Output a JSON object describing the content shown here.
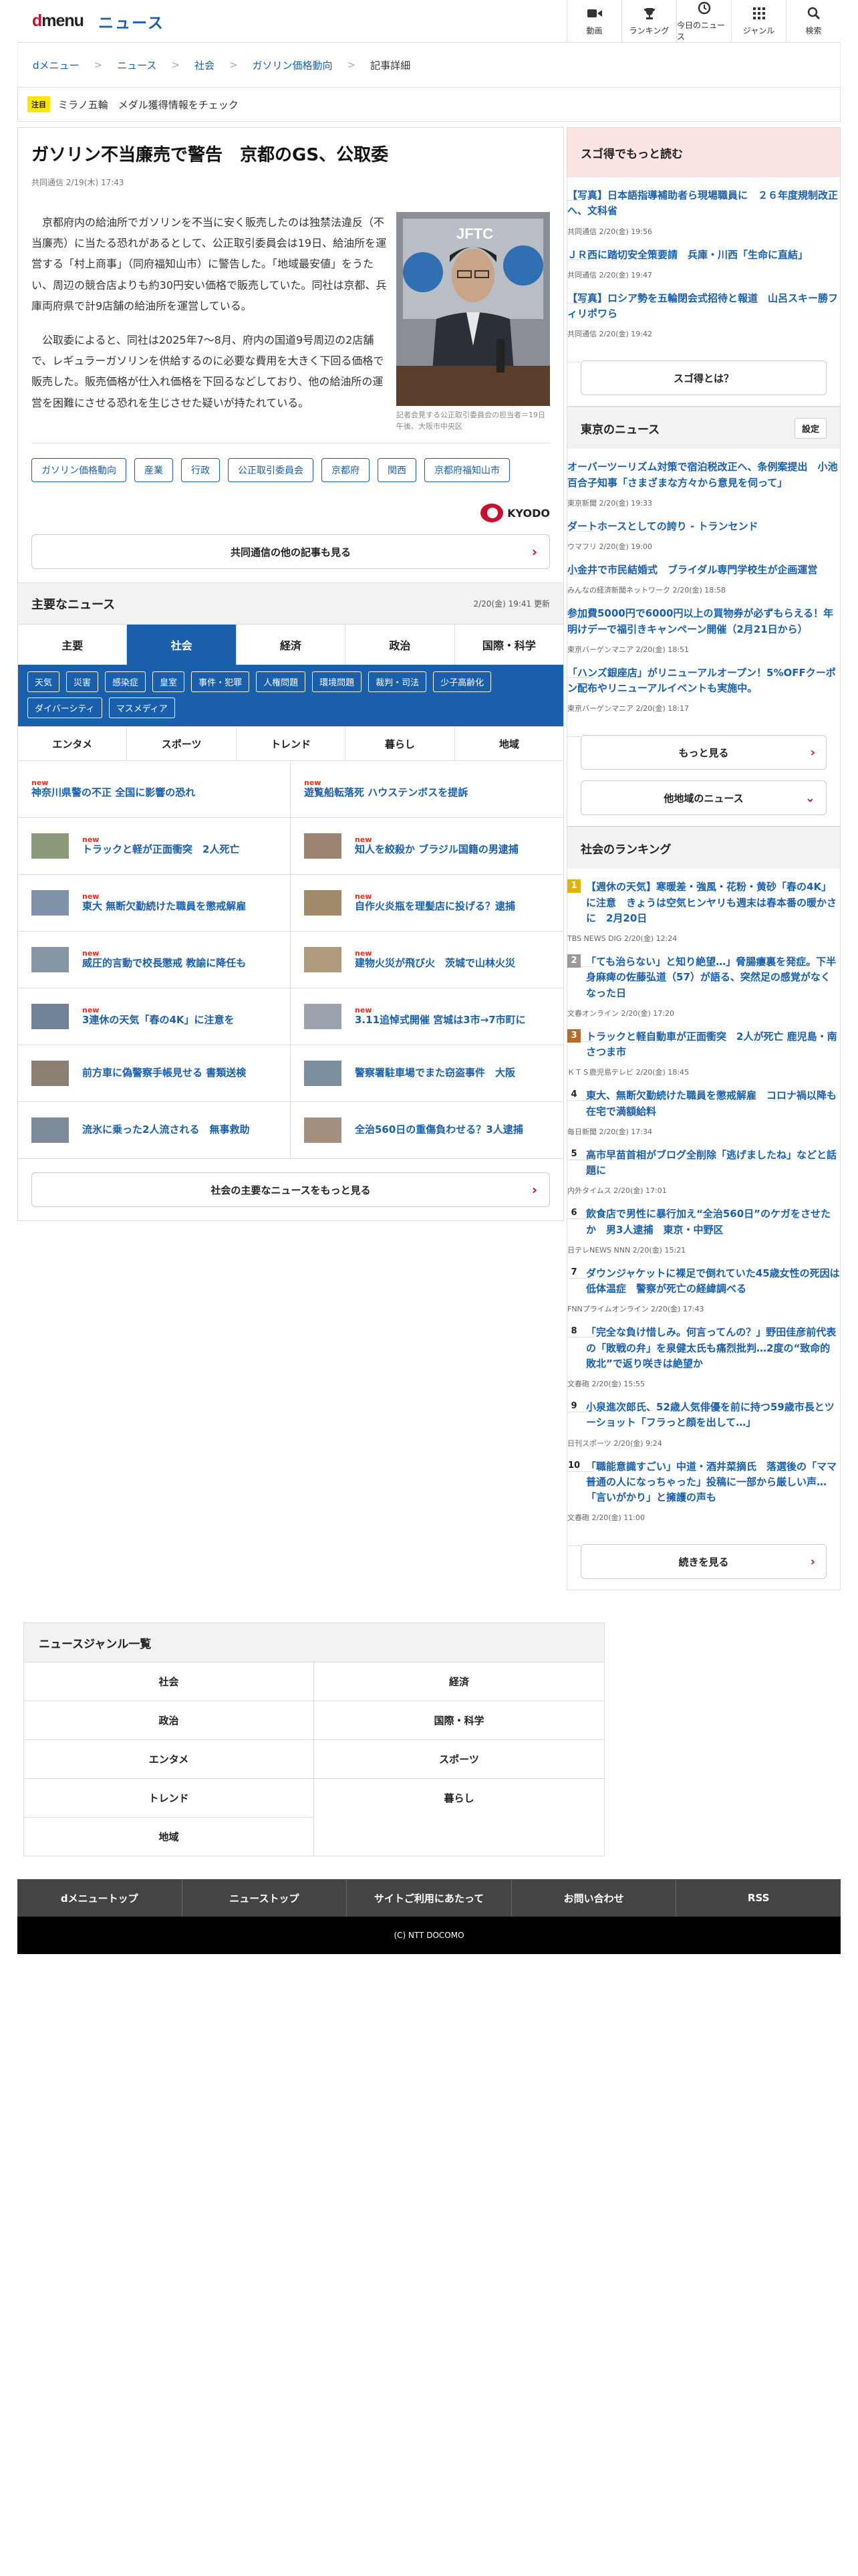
{
  "header": {
    "logo_d": "d",
    "logo_menu": "menu",
    "news_title": "ニュース",
    "nav": [
      {
        "label": "動画",
        "icon": "video-icon"
      },
      {
        "label": "ランキング",
        "icon": "trophy-icon"
      },
      {
        "label": "今日のニュース",
        "icon": "clock-icon"
      },
      {
        "label": "ジャンル",
        "icon": "grid-icon"
      },
      {
        "label": "検索",
        "icon": "search-icon"
      }
    ]
  },
  "breadcrumb": [
    "dメニュー",
    "ニュース",
    "社会",
    "ガソリン価格動向",
    "記事詳細"
  ],
  "notice": {
    "tag": "注目",
    "text": "ミラノ五輪　メダル獲得情報をチェック"
  },
  "article": {
    "title": "ガソリン不当廉売で警告　京都のGS、公取委",
    "meta": "共同通信 2/19(木) 17:43",
    "paragraphs": [
      "京都府内の給油所でガソリンを不当に安く販売したのは独禁法違反（不当廉売）に当たる恐れがあるとして、公正取引委員会は19日、給油所を運営する「村上商事」（同府福知山市）に警告した。「地域最安値」をうたい、周辺の競合店よりも約30円安い価格で販売していた。同社は京都、兵庫両府県で計9店舗の給油所を運営している。",
      "公取委によると、同社は2025年7〜8月、府内の国道9号周辺の2店舗で、レギュラーガソリンを供給するのに必要な費用を大きく下回る価格で販売した。販売価格が仕入れ価格を下回るなどしており、他の給油所の運営を困難にさせる恐れを生じさせた疑いが持たれている。"
    ],
    "photo_caption": "記者会見する公正取引委員会の担当者＝19日午後、大阪市中央区",
    "photo_sign": "JFTC",
    "tags": [
      "ガソリン価格動向",
      "産業",
      "行政",
      "公正取引委員会",
      "京都府",
      "関西",
      "京都府福知山市"
    ],
    "source_logo": "KYODO",
    "more_button": "共同通信の他の記事も見る"
  },
  "major_news": {
    "title": "主要なニュース",
    "updated": "2/20(金) 19:41 更新",
    "tabs": [
      "主要",
      "社会",
      "経済",
      "政治",
      "国際・科学"
    ],
    "active_tab": "社会",
    "subtags": [
      "天気",
      "災害",
      "感染症",
      "皇室",
      "事件・犯罪",
      "人権問題",
      "環境問題",
      "裁判・司法",
      "少子高齢化",
      "ダイバーシティ",
      "マスメディア"
    ],
    "tabs2": [
      "エンタメ",
      "スポーツ",
      "トレンド",
      "暮らし",
      "地域"
    ],
    "new_label": "new",
    "items": [
      {
        "title": "神奈川県警の不正 全国に影響の恐れ",
        "new": true,
        "thumb": false
      },
      {
        "title": "遊覧船転落死 ハウステンボスを提訴",
        "new": true,
        "thumb": false
      },
      {
        "title": "トラックと軽が正面衝突　2人死亡",
        "new": true,
        "thumb": true
      },
      {
        "title": "知人を絞殺か ブラジル国籍の男逮捕",
        "new": true,
        "thumb": true
      },
      {
        "title": "東大 無断欠勤続けた職員を懲戒解雇",
        "new": true,
        "thumb": true
      },
      {
        "title": "自作火炎瓶を理髪店に投げる？逮捕",
        "new": true,
        "thumb": true
      },
      {
        "title": "威圧的言動で校長懲戒 教諭に降任も",
        "new": true,
        "thumb": true
      },
      {
        "title": "建物火災が飛び火　茨城で山林火災",
        "new": true,
        "thumb": true
      },
      {
        "title": "3連休の天気「春の4K」に注意を",
        "new": true,
        "thumb": true
      },
      {
        "title": "3.11追悼式開催 宮城は3市→7市町に",
        "new": true,
        "thumb": true
      },
      {
        "title": "前方車に偽警察手帳見せる 書類送検",
        "new": false,
        "thumb": true
      },
      {
        "title": "警察署駐車場でまた窃盗事件　大阪",
        "new": false,
        "thumb": true
      },
      {
        "title": "流氷に乗った2人流される　無事救助",
        "new": false,
        "thumb": true
      },
      {
        "title": "全治560日の重傷負わせる？3人逮捕",
        "new": false,
        "thumb": true
      }
    ],
    "more_button": "社会の主要なニュースをもっと見る"
  },
  "sidebar": {
    "sugotoku": {
      "title": "スゴ得でもっと読む",
      "items": [
        {
          "title": "【写真】日本語指導補助者ら現場職員に　２６年度規制改正へ、文科省",
          "meta": "共同通信 2/20(金) 19:56"
        },
        {
          "title": "ＪＲ西に踏切安全策要請　兵庫・川西「生命に直結」",
          "meta": "共同通信 2/20(金) 19:47"
        },
        {
          "title": "【写真】ロシア勢を五輪閉会式招待と報道　山呂スキー勝フィリポワら",
          "meta": "共同通信 2/20(金) 19:42"
        }
      ],
      "button": "スゴ得とは？"
    },
    "tokyo": {
      "title": "東京のニュース",
      "settings": "設定",
      "items": [
        {
          "title": "オーバーツーリズム対策で宿泊税改正へ、条例案提出　小池百合子知事「さまざまな方々から意見を伺って」",
          "meta": "東京新聞 2/20(金) 19:33"
        },
        {
          "title": "ダートホースとしての誇り - トランセンド",
          "meta": "ウマフリ 2/20(金) 19:00"
        },
        {
          "title": "小金井で市民結婚式　ブライダル専門学校生が企画運営",
          "meta": "みんなの経済新聞ネットワーク 2/20(金) 18:58"
        },
        {
          "title": "参加費5000円で6000円以上の買物券が必ずもらえる！年明けデーで福引きキャンペーン開催（2月21日から）",
          "meta": "東京バーゲンマニア 2/20(金) 18:51"
        },
        {
          "title": "「ハンズ銀座店」がリニューアルオープン！5%OFFクーポン配布やリニューアルイベントも実施中。",
          "meta": "東京バーゲンマニア 2/20(金) 18:17"
        }
      ],
      "more_button": "もっと見る",
      "other_button": "他地域のニュース"
    },
    "ranking": {
      "title": "社会のランキング",
      "items": [
        {
          "rank": "1",
          "title": "【週休の天気】寒暖差・強風・花粉・黄砂「春の4K」に注意　きょうは空気ヒンヤリも週末は春本番の暖かさに　2月20日",
          "meta": "TBS NEWS DIG 2/20(金) 12:24"
        },
        {
          "rank": "2",
          "title": "「ても治らない」と知り絶望…」脅腸瘻裏を発症。下半身麻痺の佐藤弘道（57）が語る、突然足の感覚がなくなった日",
          "meta": "文春オンライン 2/20(金) 17:20"
        },
        {
          "rank": "3",
          "title": "トラックと軽自動車が正面衝突　2人が死亡 鹿児島・南さつま市",
          "meta": "ＫＴＳ鹿児島テレビ 2/20(金) 18:45"
        },
        {
          "rank": "4",
          "title": "東大、無断欠勤続けた職員を懲戒解雇　コロナ禍以降も在宅で満額給料",
          "meta": "毎日新聞 2/20(金) 17:34"
        },
        {
          "rank": "5",
          "title": "高市早苗首相がブログ全削除「逃げましたね」などと話題に",
          "meta": "内外タイムス 2/20(金) 17:01"
        },
        {
          "rank": "6",
          "title": "飲食店で男性に暴行加え“全治560日”のケガをさせたか　男3人逮捕　東京・中野区",
          "meta": "日テレNEWS NNN 2/20(金) 15:21"
        },
        {
          "rank": "7",
          "title": "ダウンジャケットに裸足で倒れていた45歳女性の死因は低体温症　警察が死亡の経緯調べる",
          "meta": "FNNプライムオンライン 2/20(金) 17:43"
        },
        {
          "rank": "8",
          "title": "「完全な負け惜しみ。何言ってんの？」野田佳彦前代表の「敗戦の弁」を泉健太氏も痛烈批判…2度の“致命的敗北”で返り咲きは絶望か",
          "meta": "文春砲 2/20(金) 15:55"
        },
        {
          "rank": "9",
          "title": "小泉進次郎氏、52歳人気俳優を前に持つ59歳市長とツーショット「フラっと顔を出して…」",
          "meta": "日刊スポーツ 2/20(金) 9:24"
        },
        {
          "rank": "10",
          "title": "「職能意識すごい」中道・酒井菜摘氏　落選後の「ママ普通の人になっちゃった」投稿に一部から厳しい声…「言いがかり」と擁護の声も",
          "meta": "文春砲 2/20(金) 11:00"
        }
      ],
      "more_button": "続きを見る"
    }
  },
  "genre": {
    "title": "ニュースジャンル一覧",
    "items": [
      "社会",
      "経済",
      "政治",
      "国際・科学",
      "エンタメ",
      "スポーツ",
      "トレンド",
      "暮らし",
      "地域"
    ]
  },
  "footer": {
    "nav": [
      "dメニュートップ",
      "ニューストップ",
      "サイトご利用にあたって",
      "お問い合わせ",
      "RSS"
    ],
    "copyright": "(C) NTT DOCOMO"
  }
}
